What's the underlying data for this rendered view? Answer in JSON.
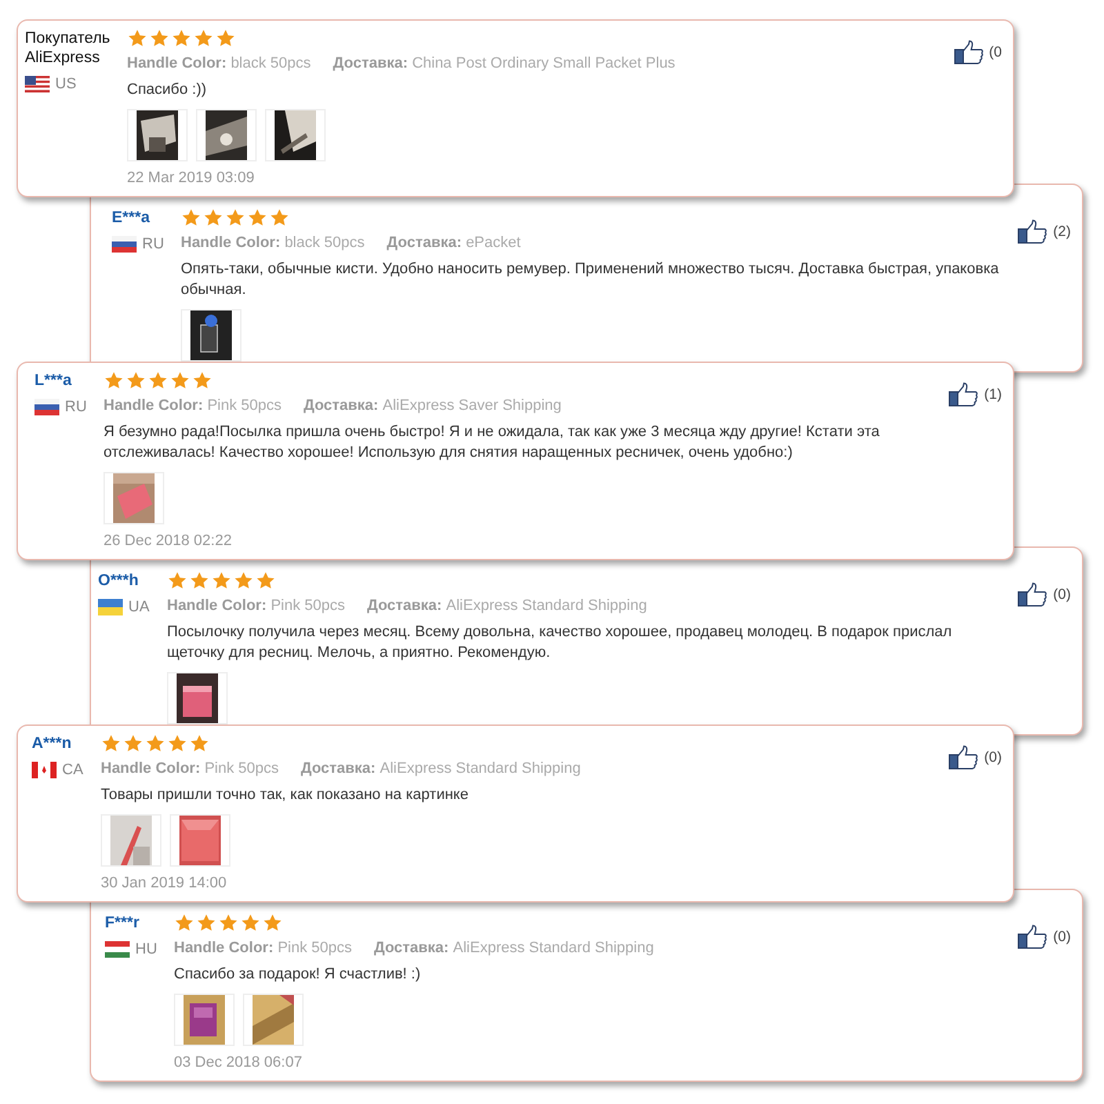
{
  "reviews": [
    {
      "name": "Покупатель AliExpress",
      "kind": "platform",
      "stars": 5,
      "flag": {
        "kind": "us"
      },
      "country": "US",
      "color_label": "Handle Color:",
      "color_value": "black 50pcs",
      "delivery_label": "Доставка:",
      "delivery_value": "China Post Ordinary Small Packet Plus",
      "text": "Спасибо :))",
      "photos": [
        {
          "kind": "picture"
        },
        {
          "kind": "picture"
        },
        {
          "kind": "picture"
        }
      ],
      "date": "22 Mar 2019 03:09",
      "likes": "(0"
    },
    {
      "name": "E***a",
      "kind": "buyer",
      "stars": 5,
      "flag": {
        "kind": "ru"
      },
      "country": "RU",
      "color_label": "Handle Color:",
      "color_value": "black 50pcs",
      "delivery_label": "Доставка:",
      "delivery_value": "ePacket",
      "text": "Опять-таки, обычные кисти. Удобно наносить ремувер. Применений множество тысяч. Доставка быстрая, упаковка обычная.",
      "photos": [
        {
          "kind": "picture"
        }
      ],
      "likes": "(2)"
    },
    {
      "name": "L***a",
      "kind": "buyer",
      "stars": 5,
      "flag": {
        "kind": "ru"
      },
      "country": "RU",
      "color_label": "Handle Color:",
      "color_value": "Pink 50pcs",
      "delivery_label": "Доставка:",
      "delivery_value": "AliExpress Saver Shipping",
      "text": "Я безумно рада!Посылка пришла очень быстро! Я и не ожидала, так как уже 3 месяца жду другие! Кстати эта отслеживалась! Качество хорошее! Использую для снятия наращенных ресничек, очень удобно:)",
      "photos": [
        {
          "kind": "picture"
        }
      ],
      "date": "26 Dec 2018 02:22",
      "likes": "(1)"
    },
    {
      "name": "O***h",
      "kind": "buyer",
      "stars": 5,
      "flag": {
        "kind": "ua"
      },
      "country": "UA",
      "color_label": "Handle Color:",
      "color_value": "Pink 50pcs",
      "delivery_label": "Доставка:",
      "delivery_value": "AliExpress Standard Shipping",
      "text": "Посылочку получила через месяц. Всему довольна, качество хорошее, продавец молодец. В подарок прислал щеточку для ресниц. Мелочь, а приятно. Рекомендую.",
      "photos": [
        {
          "kind": "picture"
        }
      ],
      "likes": "(0)"
    },
    {
      "name": "A***n",
      "kind": "buyer",
      "stars": 5,
      "flag": {
        "kind": "ca"
      },
      "country": "CA",
      "color_label": "Handle Color:",
      "color_value": "Pink 50pcs",
      "delivery_label": "Доставка:",
      "delivery_value": "AliExpress Standard Shipping",
      "text": "Товары пришли точно так, как показано на картинке",
      "photos": [
        {
          "kind": "picture"
        },
        {
          "kind": "picture"
        }
      ],
      "date": "30 Jan 2019 14:00",
      "likes": "(0)"
    },
    {
      "name": "F***r",
      "kind": "buyer",
      "stars": 5,
      "flag": {
        "kind": "hu"
      },
      "country": "HU",
      "color_label": "Handle Color:",
      "color_value": "Pink 50pcs",
      "delivery_label": "Доставка:",
      "delivery_value": "AliExpress Standard Shipping",
      "text": "Спасибо за подарок! Я счастлив! :)",
      "photos": [
        {
          "kind": "picture"
        },
        {
          "kind": "picture"
        }
      ],
      "date": "03 Dec 2018 06:07",
      "likes": "(0)"
    }
  ]
}
